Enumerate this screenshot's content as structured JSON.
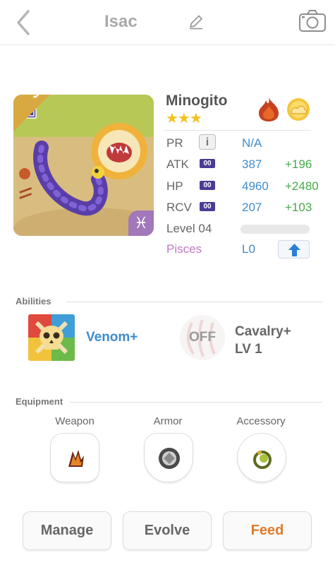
{
  "header": {
    "title": "Isac",
    "icons": {
      "back": "chevron-left-icon",
      "edit": "pencil-icon",
      "camera": "camera-icon"
    }
  },
  "monster": {
    "name": "Minogito",
    "rarity_letter": "R",
    "ribbon": "Super",
    "sign_symbol": "♓",
    "stars": "★★★",
    "star_count": 3,
    "elements": [
      "fire-icon",
      "cloud-icon"
    ]
  },
  "stats": {
    "pr": {
      "label": "PR",
      "info": "i",
      "value": "N/A"
    },
    "atk": {
      "label": "ATK",
      "tag": "00",
      "value": "387",
      "bonus": "+196"
    },
    "hp": {
      "label": "HP",
      "tag": "00",
      "value": "4960",
      "bonus": "+2480"
    },
    "rcv": {
      "label": "RCV",
      "tag": "00",
      "value": "207",
      "bonus": "+103"
    },
    "level": {
      "label": "Level 04",
      "progress": 0.0
    },
    "sign": {
      "label": "Pisces",
      "value": "L0"
    }
  },
  "abilities": {
    "title": "Abilities",
    "items": [
      {
        "name": "Venom+"
      },
      {
        "status": "OFF",
        "name_line1": "Cavalry+",
        "name_line2": "LV 1"
      }
    ]
  },
  "equipment": {
    "title": "Equipment",
    "slots": [
      {
        "label": "Weapon"
      },
      {
        "label": "Armor"
      },
      {
        "label": "Accessory"
      }
    ]
  },
  "actions": {
    "manage": "Manage",
    "evolve": "Evolve",
    "feed": "Feed"
  },
  "colors": {
    "accent_blue": "#3e8ccc",
    "bonus_green": "#46a94a",
    "feed_orange": "#e07a2c",
    "sign_pink": "#c178c2",
    "star_yellow": "#f4c21a"
  }
}
